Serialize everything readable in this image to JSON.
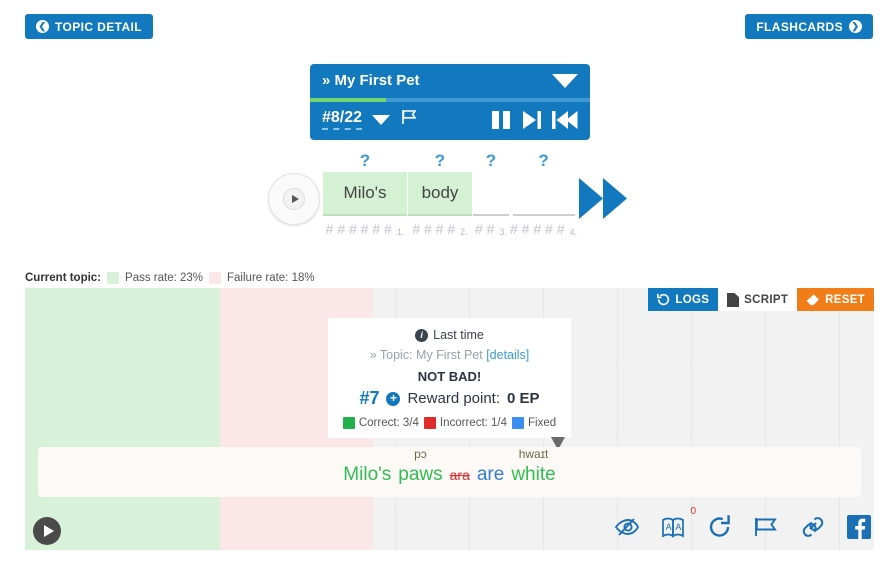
{
  "topbar": {
    "back_label": "TOPIC DETAIL",
    "back_icon": "chevron-left-circle-icon",
    "flashcards_label": "FLASHCARDS",
    "flashcards_icon": "chevron-right-circle-icon"
  },
  "player": {
    "title_prefix": "»",
    "title": "My First Pet",
    "progress_percent": 27,
    "track_number": "#8/22",
    "dropdown_icon": "chevron-down-icon",
    "flag_icon": "flag-icon",
    "controls": [
      "pause-icon",
      "next-track-icon",
      "rewind-icon"
    ]
  },
  "quiz": {
    "play_icon": "play-icon",
    "forward_icon": "fast-forward-icon",
    "tiles": [
      {
        "hint": "?",
        "word": "Milo's",
        "hashes": "######",
        "index": "1.",
        "filled": true
      },
      {
        "hint": "?",
        "word": "body",
        "hashes": "####",
        "index": "2.",
        "filled": true
      },
      {
        "hint": "?",
        "word": "",
        "hashes": "##",
        "index": "3.",
        "filled": false
      },
      {
        "hint": "?",
        "word": "",
        "hashes": "#####",
        "index": "4.",
        "filled": false
      }
    ]
  },
  "legend": {
    "label": "Current topic:",
    "pass_text": "Pass rate: 23%",
    "fail_text": "Failure rate: 18%",
    "pass_color": "#d8f2d9",
    "fail_color": "#fbe6e8",
    "pass_percent": 23,
    "fail_percent": 18
  },
  "board_buttons": [
    {
      "label": "LOGS",
      "icon": "history-icon",
      "style": "logs"
    },
    {
      "label": "SCRIPT",
      "icon": "document-icon",
      "style": "script"
    },
    {
      "label": "RESET",
      "icon": "eraser-icon",
      "style": "reset"
    }
  ],
  "card": {
    "info_icon": "info-icon",
    "last_time": "Last time",
    "topic_prefix": "» Topic: ",
    "topic_name": "My First Pet",
    "details_link": "[details]",
    "verdict": "NOT BAD!",
    "rank": "#7",
    "plus_icon": "plus-circle-icon",
    "reward_label": "Reward point:",
    "reward_value": "0 EP",
    "stats": [
      {
        "label": "Correct: 3/4",
        "color": "#22b14c"
      },
      {
        "label": "Incorrect: 1/4",
        "color": "#e02b2b"
      },
      {
        "label": "Fixed",
        "color": "#3a8ff0"
      }
    ]
  },
  "sentence": {
    "words": [
      {
        "text": "Milo's",
        "style": "green",
        "phonetic": ""
      },
      {
        "text": "paws",
        "style": "green",
        "phonetic": "pɔ"
      },
      {
        "text": "ara",
        "style": "strike",
        "phonetic": ""
      },
      {
        "text": "are",
        "style": "blue",
        "phonetic": ""
      },
      {
        "text": "white",
        "style": "green",
        "phonetic": "hwaɪt"
      }
    ]
  },
  "bottom": {
    "play_icon": "play-icon",
    "icons": [
      {
        "name": "eye-slash-icon",
        "badge": ""
      },
      {
        "name": "translate-icon",
        "badge": "0"
      },
      {
        "name": "refresh-icon",
        "badge": ""
      },
      {
        "name": "flag-icon",
        "badge": ""
      },
      {
        "name": "link-icon",
        "badge": ""
      },
      {
        "name": "facebook-icon",
        "badge": ""
      }
    ]
  }
}
